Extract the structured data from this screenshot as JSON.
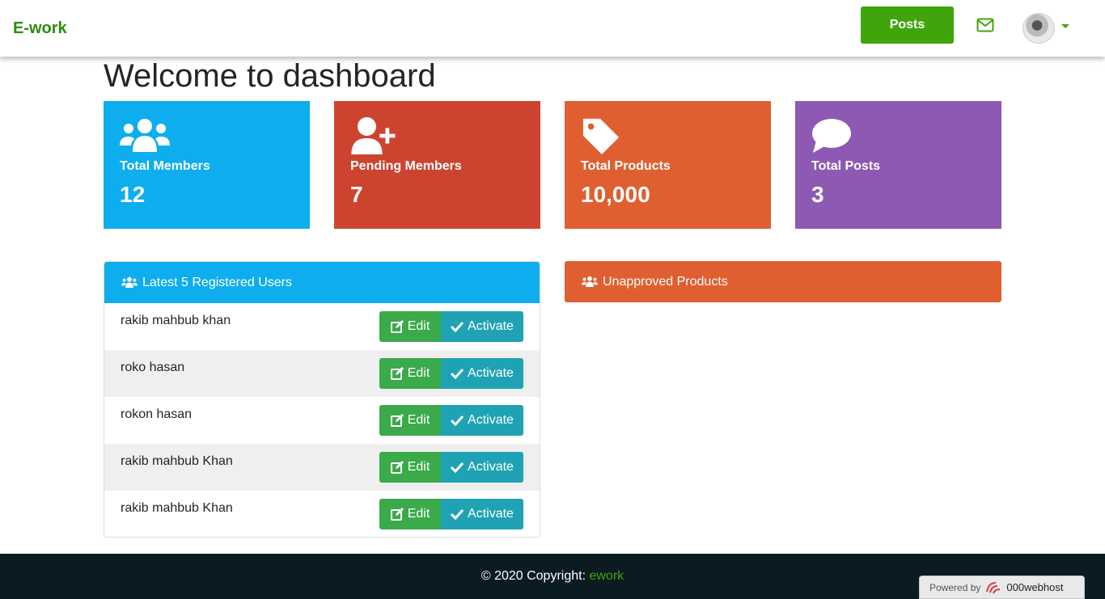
{
  "navbar": {
    "brand": "E-work",
    "posts_label": "Posts"
  },
  "page": {
    "title": "Welcome to dashboard"
  },
  "stats": [
    {
      "label": "Total Members",
      "value": "12",
      "icon": "users-icon",
      "color": "#0eaeee"
    },
    {
      "label": "Pending Members",
      "value": "7",
      "icon": "user-plus-icon",
      "color": "#cc4430"
    },
    {
      "label": "Total Products",
      "value": "10,000",
      "icon": "tag-icon",
      "color": "#e05f31"
    },
    {
      "label": "Total Posts",
      "value": "3",
      "icon": "comment-icon",
      "color": "#8e59b3"
    }
  ],
  "latest_users": {
    "title": "Latest 5 Registered Users",
    "edit_label": "Edit",
    "activate_label": "Activate",
    "users": [
      "rakib mahbub khan",
      "roko hasan",
      "rokon hasan",
      "rakib mahbub Khan",
      "rakib mahbub Khan"
    ]
  },
  "unapproved": {
    "title": "Unapproved Products"
  },
  "footer": {
    "copyright": "© 2020 Copyright: ",
    "link": "ework",
    "powered_by": "Powered by",
    "host": "000webhost"
  },
  "colors": {
    "brand": "#2e8b0f",
    "accent": "#3fa50a",
    "edit": "#3aaa4a",
    "activate": "#1fa3b4",
    "footer_bg": "#0a1b22"
  }
}
